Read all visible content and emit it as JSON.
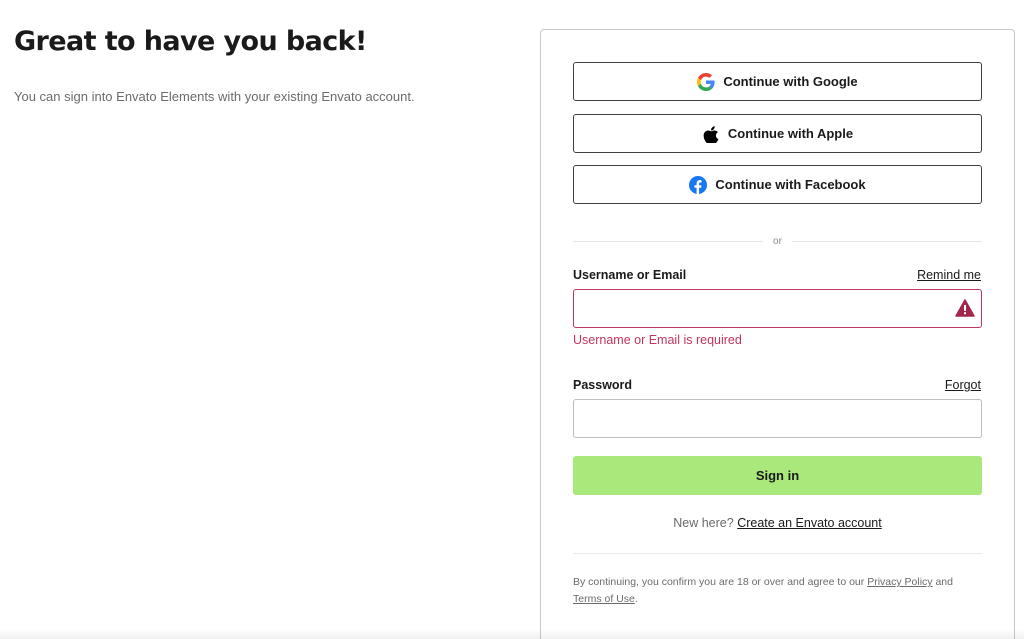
{
  "intro": {
    "heading": "Great to have you back!",
    "subtext": "You can sign into Envato Elements with your existing Envato account."
  },
  "social": {
    "google_label": "Continue with Google",
    "apple_label": "Continue with Apple",
    "facebook_label": "Continue with Facebook"
  },
  "divider_text": "or",
  "username": {
    "label": "Username or Email",
    "link": "Remind me",
    "value": "",
    "error": "Username or Email is required"
  },
  "password": {
    "label": "Password",
    "link": "Forgot",
    "value": ""
  },
  "signin_label": "Sign in",
  "signup": {
    "prefix": "New here?",
    "link": "Create an Envato account"
  },
  "legal": {
    "text1": "By continuing, you confirm you are 18 or over and agree to our",
    "privacy": "Privacy Policy",
    "and": "and",
    "terms": "Terms of Use",
    "end": "."
  },
  "colors": {
    "accent_green": "#a9e87a",
    "error": "#c0365e",
    "facebook_blue": "#1877f2"
  },
  "icons": [
    "google-icon",
    "apple-icon",
    "facebook-icon",
    "warning-icon"
  ]
}
